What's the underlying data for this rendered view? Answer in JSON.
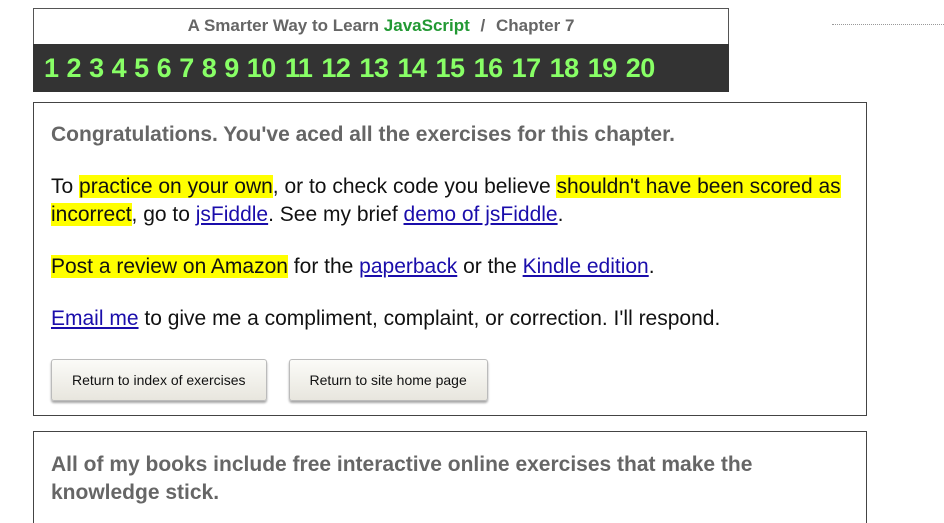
{
  "header": {
    "title_prefix": "A Smarter Way to Learn",
    "title_brand": "JavaScript",
    "separator": "/",
    "chapter": "Chapter 7",
    "chapters": [
      "1",
      "2",
      "3",
      "4",
      "5",
      "6",
      "7",
      "8",
      "9",
      "10",
      "11",
      "12",
      "13",
      "14",
      "15",
      "16",
      "17",
      "18",
      "19",
      "20"
    ]
  },
  "colors": {
    "brand": "#229933",
    "chapter_bar": "#333333",
    "chapter_link": "#88ff66",
    "highlight": "#ffff00",
    "link": "#1a0dab"
  },
  "main": {
    "congrats": "Congratulations. You've aced all the exercises for this chapter.",
    "p1": {
      "t1": "To ",
      "h1": "practice on your own",
      "t2": ", or to check code you believe ",
      "h2": "shouldn't have been scored as incorrect",
      "t3": ", go to ",
      "link1": "jsFiddle",
      "t4": ". See my brief ",
      "link2": "demo of jsFiddle",
      "t5": "."
    },
    "p2": {
      "h1": "Post a review on Amazon",
      "t1": " for the ",
      "link1": "paperback",
      "t2": " or the ",
      "link2": "Kindle edition",
      "t3": "."
    },
    "p3": {
      "link1": "Email me",
      "t1": " to give me a compliment, complaint, or correction. I'll respond."
    },
    "buttons": {
      "index": "Return to index of exercises",
      "home": "Return to site home page"
    }
  },
  "books": {
    "text": "All of my books include free interactive online exercises that make the knowledge stick."
  }
}
